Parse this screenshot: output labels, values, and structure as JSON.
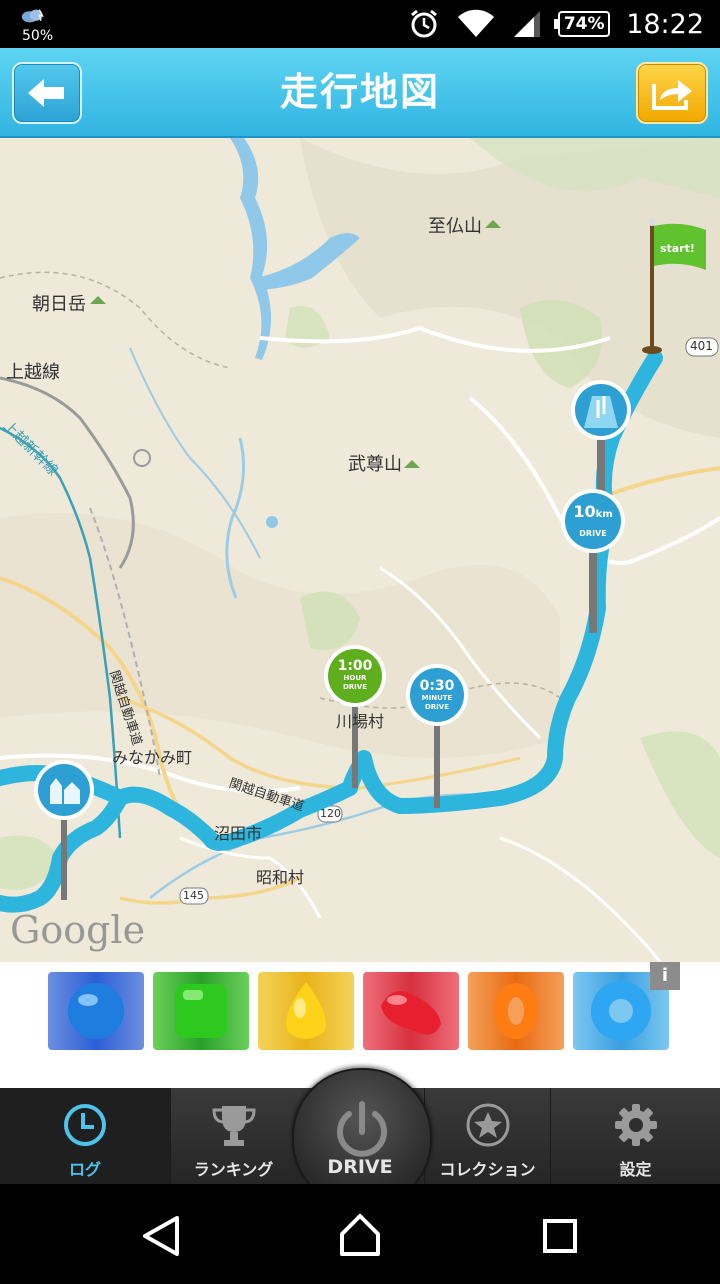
{
  "status_bar": {
    "weather_percent": "50%",
    "battery": "74%",
    "time": "18:22",
    "icons": [
      "weather-cloud-icon",
      "alarm-icon",
      "wifi-icon",
      "signal-icon",
      "battery-icon"
    ]
  },
  "header": {
    "title": "走行地図",
    "back_icon": "back-arrow-icon",
    "share_icon": "share-icon"
  },
  "map": {
    "labels": {
      "shibutsu": "至仏山",
      "asahi": "朝日岳",
      "joetsu_line": "上越線",
      "joetsu_shinkansen": "上越新幹線",
      "buson": "武尊山",
      "kawaba": "川場村",
      "minakami": "みなかみ町",
      "kanetsu1": "関越自動車道",
      "kanetsu2": "関越自動車道",
      "numata": "沼田市",
      "showa": "昭和村",
      "route401": "401",
      "route120": "120",
      "route145": "145"
    },
    "start_flag": "start!",
    "markers": {
      "hour": {
        "top": "1:00",
        "mid": "HOUR",
        "bot": "DRIVE"
      },
      "minute": {
        "top": "0:30",
        "mid": "MINUTE",
        "bot": "DRIVE"
      },
      "km": {
        "top": "10",
        "unit": "km",
        "bot": "DRIVE"
      }
    },
    "attribution": "Google",
    "colors": {
      "route": "#2eb5de",
      "land": "#efe9da",
      "water": "#8fc8e8"
    }
  },
  "ad": {
    "info": "i",
    "candies": [
      "blue-candy",
      "green-candy",
      "yellow-candy",
      "red-candy",
      "orange-candy",
      "blue-ring-candy"
    ]
  },
  "tabs": {
    "log": "ログ",
    "ranking": "ランキング",
    "drive": "DRIVE",
    "collection": "コレクション",
    "settings": "設定"
  },
  "nav": {
    "back": "back-icon",
    "home": "home-icon",
    "recent": "recent-apps-icon"
  }
}
